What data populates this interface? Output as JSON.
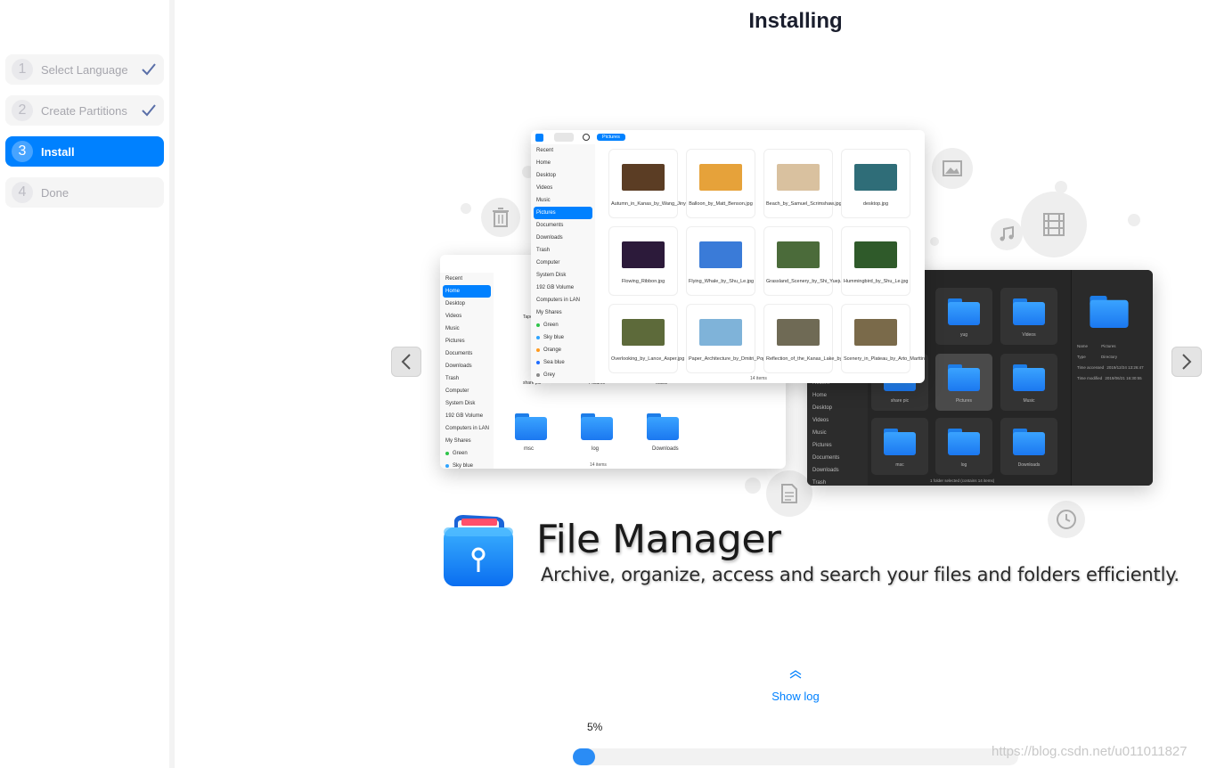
{
  "steps": [
    {
      "num": "1",
      "label": "Select Language",
      "state": "done"
    },
    {
      "num": "2",
      "label": "Create Partitions",
      "state": "done"
    },
    {
      "num": "3",
      "label": "Install",
      "state": "active"
    },
    {
      "num": "4",
      "label": "Done",
      "state": "pending"
    }
  ],
  "header": {
    "title": "Installing"
  },
  "slide": {
    "app_name": "File Manager",
    "app_desc": "Archive, organize, access and search your files and folders efficiently.",
    "preview": {
      "location_tab": "Pictures",
      "sidebar_items": [
        "Recent",
        "Home",
        "Desktop",
        "Videos",
        "Music",
        "Pictures",
        "Documents",
        "Downloads",
        "Trash",
        "Computer",
        "System Disk",
        "192 GB Volume",
        "Computers in LAN",
        "My Shares",
        "Green",
        "Sky blue",
        "Orange",
        "Sea blue",
        "Grey"
      ],
      "tag_colors": {
        "Green": "#2fc44a",
        "Sky blue": "#2fa4ff",
        "Orange": "#ff9a1f",
        "Sea blue": "#1f6cff",
        "Grey": "#8a8a8a"
      },
      "thumbnails": [
        {
          "caption": "Autumn_in_Kanas_by_Wang_Jinyu.jpg",
          "color": "#5b3d24"
        },
        {
          "caption": "Balloon_by_Matt_Benson.jpg",
          "color": "#e6a23a"
        },
        {
          "caption": "Beach_by_Samuel_Scrimshaw.jpg",
          "color": "#d9c19f"
        },
        {
          "caption": "desktop.jpg",
          "color": "#2f6d78"
        },
        {
          "caption": "Flowing_Ribbon.jpg",
          "color": "#2c1a3a"
        },
        {
          "caption": "Flying_Whale_by_Shu_Le.jpg",
          "color": "#3a7bd8"
        },
        {
          "caption": "Grassland_Scenery_by_Shi_Yuejun.jpg",
          "color": "#4b6b3a"
        },
        {
          "caption": "Hummingbird_by_Shu_Le.jpg",
          "color": "#2f5a2a"
        },
        {
          "caption": "Overlooking_by_Lance_Asper.jpg",
          "color": "#5d6a3a"
        },
        {
          "caption": "Paper_Architecture_by_Dmitri_Popov.jpg",
          "color": "#7fb3d9"
        },
        {
          "caption": "Reflection_of_the_Kanas_Lake_by_Wang_Jinyu.jpg",
          "color": "#6f6a55"
        },
        {
          "caption": "Scenery_in_Plateau_by_Arto_Marttinen.jpg",
          "color": "#7a6a4a"
        }
      ],
      "status_top": "14 items",
      "left_folders": [
        "msc",
        "log",
        "Downloads"
      ],
      "left_partial_labels": [
        "Tape",
        "share pic",
        "Pictures",
        "Music"
      ],
      "left_status": "14 items",
      "dark_folders": [
        "yug",
        "Videos",
        "share pic",
        "Pictures",
        "Music",
        "msc",
        "log",
        "Downloads"
      ],
      "dark_status": "1 folder selected (contains 14 items)",
      "detail": {
        "name_label": "Name",
        "name_value": "Pictures",
        "type_label": "Type",
        "type_value": "Directory",
        "accessed_label": "Time accessed",
        "accessed_value": "2019/12/24 13:26:47",
        "modified_label": "Time modified",
        "modified_value": "2019/06/21 16:30:55"
      }
    }
  },
  "log": {
    "label": "Show log"
  },
  "progress": {
    "percent_text": "5%",
    "value": 0.05
  },
  "watermark": "https://blog.csdn.net/u011011827"
}
